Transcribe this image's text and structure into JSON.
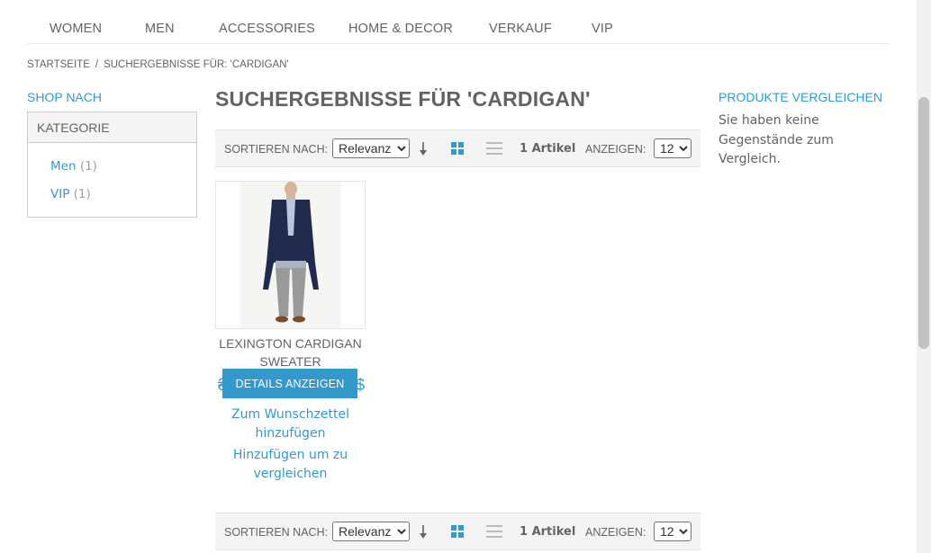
{
  "nav": [
    "WOMEN",
    "MEN",
    "ACCESSORIES",
    "HOME & DECOR",
    "VERKAUF",
    "VIP"
  ],
  "breadcrumb": {
    "home": "STARTSEITE",
    "separator": "/",
    "current": "SUCHERGEBNISSE FÜR: 'CARDIGAN'"
  },
  "sidebar": {
    "shop_by": "SHOP NACH",
    "category_title": "KATEGORIE",
    "options": [
      {
        "label": "Men",
        "count": "(1)"
      },
      {
        "label": "VIP",
        "count": "(1)"
      }
    ]
  },
  "page_title": "SUCHERGEBNISSE FÜR 'CARDIGAN'",
  "toolbar": {
    "sort_label": "SORTIEREN NACH:",
    "sort_value": "Relevanz",
    "count": "1 Artikel",
    "show_label": "ANZEIGEN:",
    "show_value": "12"
  },
  "product": {
    "name": "LEXINGTON CARDIGAN SWEATER",
    "button": "DETAILS ANZEIGEN",
    "wishlist": "Zum Wunschzettel hinzufügen",
    "compare": "Hinzufügen um zu vergleichen"
  },
  "compare": {
    "title": "PRODUKTE VERGLEICHEN",
    "text": "Sie haben keine Gegenstände zum Vergleich."
  },
  "colors": {
    "accent": "#3399cc",
    "text": "#636363",
    "toolbar_bg": "#f4f4f4"
  },
  "icons": [
    "sort-arrow-icon",
    "grid-view-icon",
    "list-view-icon"
  ]
}
